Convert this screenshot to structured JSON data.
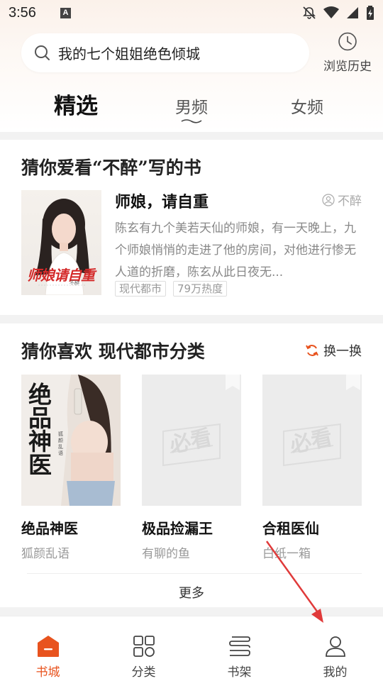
{
  "status_bar": {
    "time": "3:56",
    "a_badge": "A"
  },
  "search": {
    "query": "我的七个姐姐绝色倾城"
  },
  "history": {
    "label": "浏览历史"
  },
  "tabs": [
    {
      "label": "精选",
      "active": true
    },
    {
      "label": "男频",
      "active": false
    },
    {
      "label": "女频",
      "active": false
    }
  ],
  "recommend_author": {
    "title": "猜你爱看“不醉”写的书",
    "book": {
      "cover_title": "师娘请自重",
      "cover_author": "不醉",
      "name": "师娘，请自重",
      "author": "不醉",
      "description": "陈玄有九个美若天仙的师娘，有一天晚上，九个师娘悄悄的走进了他的房间，对他进行惨无人道的折磨，陈玄从此日夜无...",
      "tags": [
        "现代都市",
        "79万热度"
      ]
    }
  },
  "guess_like": {
    "title": "猜你喜欢  现代都市分类",
    "refresh_label": "换一换",
    "books": [
      {
        "name": "绝品神医",
        "author": "狐颜乱语",
        "cover_title": "绝品神医",
        "cover_author": "狐颜乱语"
      },
      {
        "name": "极品捡漏王",
        "author": "有聊的鱼",
        "placeholder_text": "必看"
      },
      {
        "name": "合租医仙",
        "author": "白纸一箱",
        "placeholder_text": "必看"
      }
    ],
    "more_label": "更多"
  },
  "bottom_nav": [
    {
      "label": "书城",
      "icon": "bookstore-icon",
      "active": true
    },
    {
      "label": "分类",
      "icon": "category-icon",
      "active": false
    },
    {
      "label": "书架",
      "icon": "bookshelf-icon",
      "active": false
    },
    {
      "label": "我的",
      "icon": "profile-icon",
      "active": false
    }
  ],
  "colors": {
    "accent": "#e8531e",
    "arrow": "#e03a3a"
  }
}
